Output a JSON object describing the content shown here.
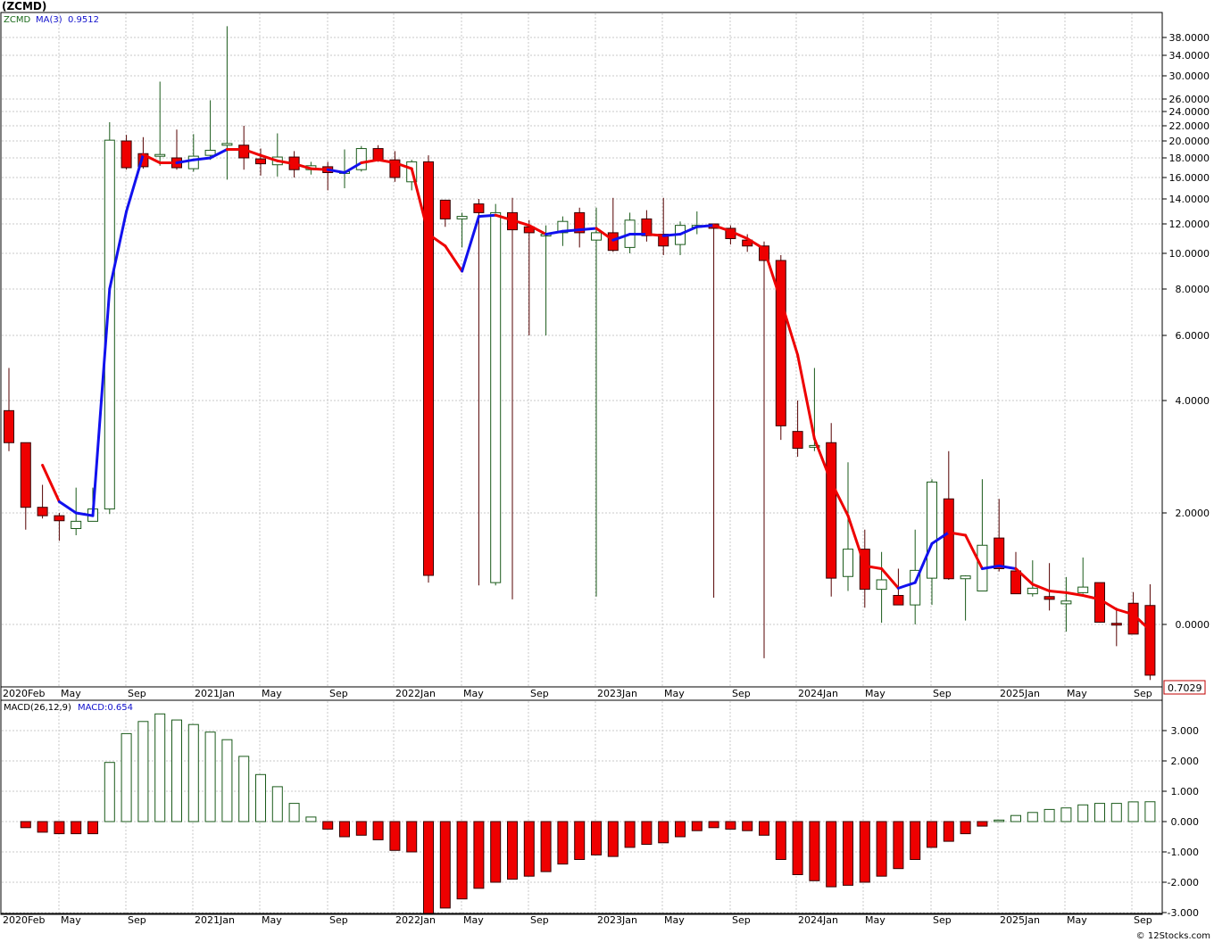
{
  "header": {
    "symbol_title": "(ZCMD)",
    "price_legend": "ZCMD",
    "ma_legend": "MA(3)",
    "ma_value": "0.9512",
    "macd_legend": "MACD(26,12,9)",
    "macd_value_legend": "MACD:0.654",
    "last_price_tag": "0.7029",
    "footer_credit": "© 12Stocks.com"
  },
  "colors": {
    "up": "#1a5a1a",
    "down": "#ee0000",
    "ma_down": "#ee0000",
    "ma_up": "#1111ee",
    "grid": "#c8c8c8",
    "legend_price": "#1a6a1a",
    "legend_ma": "#1111cc"
  },
  "chart_data": [
    {
      "type": "candlestick",
      "title": "(ZCMD)",
      "interval": "monthly",
      "scale": "log-like (labels as printed)",
      "x_tick_labels": [
        "2020Feb",
        "May",
        "Sep",
        "2021Jan",
        "May",
        "Sep",
        "2022Jan",
        "May",
        "Sep",
        "2023Jan",
        "May",
        "Sep",
        "2024Jan",
        "May",
        "Sep",
        "2025Jan",
        "May",
        "Sep"
      ],
      "y_tick_labels": [
        "38.0000",
        "34.0000",
        "30.0000",
        "26.0000",
        "24.0000",
        "22.0000",
        "20.0000",
        "18.0000",
        "16.0000",
        "14.0000",
        "12.0000",
        "10.0000",
        "8.0000",
        "6.0000",
        "4.0000",
        "2.0000",
        "0.0000"
      ],
      "grid": true,
      "last_value": 0.7029,
      "candles": [
        {
          "period": "2020-02",
          "o": 3.82,
          "h": 5.0,
          "l": 3.1,
          "c": 3.25
        },
        {
          "period": "2020-03",
          "o": 3.25,
          "h": 3.25,
          "l": 1.7,
          "c": 2.1
        },
        {
          "period": "2020-04",
          "o": 2.1,
          "h": 2.5,
          "l": 1.9,
          "c": 1.95
        },
        {
          "period": "2020-05",
          "o": 1.95,
          "h": 2.0,
          "l": 1.5,
          "c": 1.86
        },
        {
          "period": "2020-06",
          "o": 1.72,
          "h": 2.45,
          "l": 1.6,
          "c": 1.85
        },
        {
          "period": "2020-07",
          "o": 1.85,
          "h": 2.45,
          "l": 1.85,
          "c": 2.07
        },
        {
          "period": "2020-08",
          "o": 2.07,
          "h": 22.5,
          "l": 1.98,
          "c": 20.1
        },
        {
          "period": "2020-09",
          "o": 20.0,
          "h": 20.8,
          "l": 16.8,
          "c": 17.0
        },
        {
          "period": "2020-10",
          "o": 18.5,
          "h": 20.5,
          "l": 16.9,
          "c": 17.1
        },
        {
          "period": "2020-11",
          "o": 18.2,
          "h": 29.0,
          "l": 17.2,
          "c": 18.4
        },
        {
          "period": "2020-12",
          "o": 18.0,
          "h": 21.5,
          "l": 16.8,
          "c": 17.0
        },
        {
          "period": "2021-01",
          "o": 16.9,
          "h": 20.9,
          "l": 16.6,
          "c": 18.2
        },
        {
          "period": "2021-02",
          "o": 18.3,
          "h": 25.8,
          "l": 17.8,
          "c": 18.9
        },
        {
          "period": "2021-03",
          "o": 19.5,
          "h": 40.8,
          "l": 15.8,
          "c": 19.7
        },
        {
          "period": "2021-04",
          "o": 19.5,
          "h": 22.0,
          "l": 16.8,
          "c": 18.0
        },
        {
          "period": "2021-05",
          "o": 17.9,
          "h": 19.1,
          "l": 16.2,
          "c": 17.4
        },
        {
          "period": "2021-06",
          "o": 17.3,
          "h": 21.0,
          "l": 16.1,
          "c": 18.1
        },
        {
          "period": "2021-07",
          "o": 18.1,
          "h": 18.8,
          "l": 16.0,
          "c": 16.8
        },
        {
          "period": "2021-08",
          "o": 16.8,
          "h": 17.6,
          "l": 16.3,
          "c": 17.2
        },
        {
          "period": "2021-09",
          "o": 17.1,
          "h": 17.6,
          "l": 14.8,
          "c": 16.5
        },
        {
          "period": "2021-10",
          "o": 16.6,
          "h": 19.0,
          "l": 15.0,
          "c": 16.6
        },
        {
          "period": "2021-11",
          "o": 16.8,
          "h": 19.4,
          "l": 16.6,
          "c": 19.1
        },
        {
          "period": "2021-12",
          "o": 19.1,
          "h": 19.5,
          "l": 17.6,
          "c": 17.8
        },
        {
          "period": "2022-01",
          "o": 17.8,
          "h": 18.8,
          "l": 15.6,
          "c": 16.0
        },
        {
          "period": "2022-02",
          "o": 15.6,
          "h": 17.8,
          "l": 14.8,
          "c": 17.6
        },
        {
          "period": "2022-03",
          "o": 17.6,
          "h": 18.3,
          "l": 0.75,
          "c": 0.88
        },
        {
          "period": "2022-04",
          "o": 13.9,
          "h": 13.9,
          "l": 11.8,
          "c": 12.4
        },
        {
          "period": "2022-05",
          "o": 12.4,
          "h": 12.9,
          "l": 10.4,
          "c": 12.6
        },
        {
          "period": "2022-06",
          "o": 13.6,
          "h": 14.0,
          "l": 0.7,
          "c": 12.9
        },
        {
          "period": "2022-07",
          "o": 0.75,
          "h": 13.6,
          "l": 0.7,
          "c": 12.9
        },
        {
          "period": "2022-08",
          "o": 12.9,
          "h": 14.1,
          "l": 0.45,
          "c": 11.6
        },
        {
          "period": "2022-09",
          "o": 11.8,
          "h": 12.3,
          "l": 6.0,
          "c": 11.4
        },
        {
          "period": "2022-10",
          "o": 11.2,
          "h": 11.9,
          "l": 6.0,
          "c": 11.3
        },
        {
          "period": "2022-11",
          "o": 11.4,
          "h": 12.6,
          "l": 10.5,
          "c": 12.2
        },
        {
          "period": "2022-12",
          "o": 12.9,
          "h": 13.3,
          "l": 10.4,
          "c": 11.4
        },
        {
          "period": "2023-01",
          "o": 10.9,
          "h": 13.3,
          "l": 0.5,
          "c": 11.4
        },
        {
          "period": "2023-02",
          "o": 11.4,
          "h": 14.1,
          "l": 10.1,
          "c": 10.2
        },
        {
          "period": "2023-03",
          "o": 10.4,
          "h": 12.9,
          "l": 10.0,
          "c": 12.3
        },
        {
          "period": "2023-04",
          "o": 12.4,
          "h": 13.1,
          "l": 10.8,
          "c": 11.2
        },
        {
          "period": "2023-05",
          "o": 11.3,
          "h": 14.1,
          "l": 9.9,
          "c": 10.5
        },
        {
          "period": "2023-06",
          "o": 10.6,
          "h": 12.2,
          "l": 9.9,
          "c": 11.9
        },
        {
          "period": "2023-07",
          "o": 11.9,
          "h": 13.0,
          "l": 11.3,
          "c": 11.9
        },
        {
          "period": "2023-08",
          "o": 12.0,
          "h": 12.0,
          "l": 0.48,
          "c": 11.7
        },
        {
          "period": "2023-09",
          "o": 11.7,
          "h": 11.9,
          "l": 10.6,
          "c": 11.0
        },
        {
          "period": "2023-10",
          "o": 10.9,
          "h": 11.3,
          "l": 10.1,
          "c": 10.5
        },
        {
          "period": "2023-11",
          "o": 10.5,
          "h": 10.8,
          "l": -0.7,
          "c": 9.6
        },
        {
          "period": "2023-12",
          "o": 9.6,
          "h": 9.9,
          "l": 3.3,
          "c": 3.55
        },
        {
          "period": "2024-01",
          "o": 3.45,
          "h": 4.0,
          "l": 3.0,
          "c": 3.15
        },
        {
          "period": "2024-02",
          "o": 3.2,
          "h": 5.0,
          "l": 3.1,
          "c": 3.2
        },
        {
          "period": "2024-03",
          "o": 3.25,
          "h": 3.6,
          "l": 0.5,
          "c": 0.83
        },
        {
          "period": "2024-04",
          "o": 0.86,
          "h": 2.9,
          "l": 0.6,
          "c": 1.35
        },
        {
          "period": "2024-05",
          "o": 1.35,
          "h": 1.7,
          "l": 0.3,
          "c": 0.63
        },
        {
          "period": "2024-06",
          "o": 0.63,
          "h": 1.3,
          "l": 0.03,
          "c": 0.8
        },
        {
          "period": "2024-07",
          "o": 0.52,
          "h": 1.0,
          "l": 0.35,
          "c": 0.35
        },
        {
          "period": "2024-08",
          "o": 0.35,
          "h": 1.7,
          "l": 0.0,
          "c": 0.97
        },
        {
          "period": "2024-09",
          "o": 0.83,
          "h": 2.6,
          "l": 0.35,
          "c": 2.55
        },
        {
          "period": "2024-10",
          "o": 2.25,
          "h": 3.1,
          "l": 0.8,
          "c": 0.82
        },
        {
          "period": "2024-11",
          "o": 0.82,
          "h": 0.88,
          "l": 0.07,
          "c": 0.87
        },
        {
          "period": "2024-12",
          "o": 0.6,
          "h": 2.6,
          "l": 0.6,
          "c": 1.42
        },
        {
          "period": "2025-01",
          "o": 1.55,
          "h": 2.25,
          "l": 0.95,
          "c": 1.0
        },
        {
          "period": "2025-02",
          "o": 0.96,
          "h": 1.3,
          "l": 0.55,
          "c": 0.55
        },
        {
          "period": "2025-03",
          "o": 0.55,
          "h": 1.15,
          "l": 0.5,
          "c": 0.65
        },
        {
          "period": "2025-04",
          "o": 0.5,
          "h": 1.1,
          "l": 0.25,
          "c": 0.45
        },
        {
          "period": "2025-05",
          "o": 0.37,
          "h": 0.85,
          "l": -0.15,
          "c": 0.42
        },
        {
          "period": "2025-06",
          "o": 0.57,
          "h": 1.2,
          "l": 0.55,
          "c": 0.67
        },
        {
          "period": "2025-07",
          "o": 0.75,
          "h": 0.75,
          "l": 0.03,
          "c": 0.04
        },
        {
          "period": "2025-08",
          "o": 0.02,
          "h": 0.3,
          "l": -0.45,
          "c": 0.01
        },
        {
          "period": "2025-09",
          "o": 0.38,
          "h": 0.58,
          "l": -0.2,
          "c": -0.2
        },
        {
          "period": "2025-10",
          "o": 0.34,
          "h": 0.72,
          "l": -1.15,
          "c": -1.05
        }
      ],
      "ma_series": {
        "name": "MA(3)",
        "color_up": "#1111ee",
        "color_down": "#ee0000",
        "values": [
          null,
          null,
          2.85,
          2.2,
          2.0,
          1.95,
          8.0,
          13.0,
          18.4,
          17.5,
          17.5,
          17.8,
          18.0,
          19.0,
          19.0,
          18.3,
          17.7,
          17.4,
          16.9,
          16.8,
          16.5,
          17.5,
          17.8,
          17.5,
          16.9,
          11.3,
          10.5,
          9.0,
          12.6,
          12.7,
          12.3,
          11.9,
          11.3,
          11.5,
          11.6,
          11.7,
          10.9,
          11.3,
          11.3,
          11.2,
          11.3,
          11.8,
          11.9,
          11.5,
          11.0,
          10.3,
          7.5,
          5.4,
          3.32,
          2.55,
          1.95,
          1.05,
          1.0,
          0.65,
          0.75,
          1.45,
          1.65,
          1.6,
          1.0,
          1.05,
          1.0,
          0.72,
          0.6,
          0.57,
          0.52,
          0.45,
          0.27,
          0.18,
          -0.12
        ],
        "direction_up": [
          false,
          false,
          false,
          false,
          true,
          true,
          true,
          true,
          true,
          false,
          false,
          true,
          true,
          true,
          false,
          false,
          false,
          false,
          false,
          false,
          true,
          true,
          false,
          false,
          false,
          false,
          false,
          false,
          true,
          true,
          false,
          false,
          false,
          true,
          true,
          true,
          false,
          true,
          true,
          false,
          true,
          true,
          true,
          false,
          false,
          false,
          false,
          false,
          false,
          false,
          false,
          false,
          false,
          false,
          true,
          true,
          true,
          false,
          false,
          true,
          true,
          false,
          false,
          false,
          false,
          false,
          false,
          false,
          false
        ]
      }
    },
    {
      "type": "bar",
      "title": "MACD(26,12,9)",
      "series": [
        {
          "name": "MACD:0.654",
          "values": [
            -0.2,
            -0.35,
            -0.4,
            -0.4,
            -0.4,
            1.95,
            2.9,
            3.3,
            3.55,
            3.35,
            3.2,
            2.95,
            2.7,
            2.15,
            1.55,
            1.15,
            0.6,
            0.15,
            -0.25,
            -0.5,
            -0.45,
            -0.6,
            -0.95,
            -1.0,
            -3.05,
            -2.85,
            -2.55,
            -2.2,
            -2.0,
            -1.9,
            -1.8,
            -1.65,
            -1.4,
            -1.25,
            -1.1,
            -1.15,
            -0.85,
            -0.75,
            -0.7,
            -0.5,
            -0.3,
            -0.2,
            -0.25,
            -0.3,
            -0.45,
            -1.25,
            -1.75,
            -1.95,
            -2.15,
            -2.1,
            -2.0,
            -1.8,
            -1.55,
            -1.25,
            -0.85,
            -0.65,
            -0.4,
            -0.15,
            0.05,
            0.2,
            0.3,
            0.4,
            0.45,
            0.55,
            0.6,
            0.6,
            0.65,
            0.654
          ]
        }
      ],
      "y_tick_labels": [
        "3.000",
        "2.000",
        "1.000",
        "0.000",
        "-1.000",
        "-2.000",
        "-3.000"
      ],
      "ylim": [
        -3.1,
        3.75
      ],
      "x_tick_labels": [
        "2020Feb",
        "May",
        "Sep",
        "2021Jan",
        "May",
        "Sep",
        "2022Jan",
        "May",
        "Sep",
        "2023Jan",
        "May",
        "Sep",
        "2024Jan",
        "May",
        "Sep",
        "2025Jan",
        "May",
        "Sep"
      ],
      "grid": true
    }
  ]
}
